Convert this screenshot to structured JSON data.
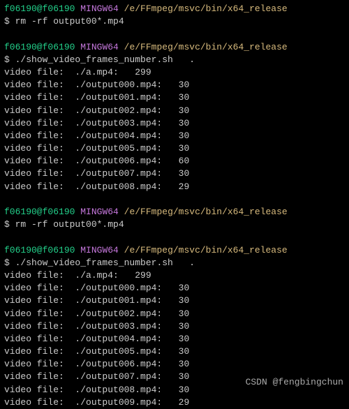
{
  "prompt1": {
    "user_host": "f06190@f06190",
    "mingw": "MINGW64",
    "path": "/e/FFmpeg/msvc/bin/x64_release",
    "cmd": "rm -rf output00*.mp4"
  },
  "prompt2": {
    "user_host": "f06190@f06190",
    "mingw": "MINGW64",
    "path": "/e/FFmpeg/msvc/bin/x64_release",
    "cmd": "./show_video_frames_number.sh   ."
  },
  "output1": [
    "video file:  ./a.mp4:   299",
    "video file:  ./output000.mp4:   30",
    "video file:  ./output001.mp4:   30",
    "video file:  ./output002.mp4:   30",
    "video file:  ./output003.mp4:   30",
    "video file:  ./output004.mp4:   30",
    "video file:  ./output005.mp4:   30",
    "video file:  ./output006.mp4:   60",
    "video file:  ./output007.mp4:   30",
    "video file:  ./output008.mp4:   29"
  ],
  "prompt3": {
    "user_host": "f06190@f06190",
    "mingw": "MINGW64",
    "path": "/e/FFmpeg/msvc/bin/x64_release",
    "cmd": "rm -rf output00*.mp4"
  },
  "prompt4": {
    "user_host": "f06190@f06190",
    "mingw": "MINGW64",
    "path": "/e/FFmpeg/msvc/bin/x64_release",
    "cmd": "./show_video_frames_number.sh   ."
  },
  "output2": [
    "video file:  ./a.mp4:   299",
    "video file:  ./output000.mp4:   30",
    "video file:  ./output001.mp4:   30",
    "video file:  ./output002.mp4:   30",
    "video file:  ./output003.mp4:   30",
    "video file:  ./output004.mp4:   30",
    "video file:  ./output005.mp4:   30",
    "video file:  ./output006.mp4:   30",
    "video file:  ./output007.mp4:   30",
    "video file:  ./output008.mp4:   30",
    "video file:  ./output009.mp4:   29"
  ],
  "watermark": "CSDN @fengbingchun",
  "dollar": "$ "
}
